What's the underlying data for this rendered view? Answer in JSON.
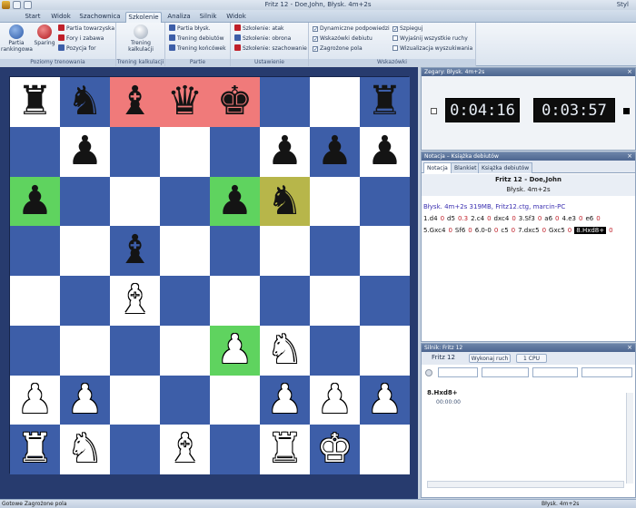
{
  "window": {
    "title": "Fritz 12 - Doe,John, Błysk. 4m+2s",
    "style_label": "Styl"
  },
  "tabs": [
    {
      "label": "Start"
    },
    {
      "label": "Widok"
    },
    {
      "label": "Szachownica"
    },
    {
      "label": "Szkolenie",
      "active": true
    },
    {
      "label": "Analiza"
    },
    {
      "label": "Silnik"
    },
    {
      "label": "Widok"
    }
  ],
  "ribbon": {
    "ranked": {
      "btn1": "Partia rankingowa",
      "btn2": "Sparing",
      "small": [
        "Partia towarzyska",
        "Fory i zabawa",
        "Pozycja for"
      ],
      "label": "Poziomy trenowania"
    },
    "calc": {
      "btn": "Trening kalkulacji",
      "label": "Trening kalkulacji"
    },
    "partie": {
      "items": [
        "Partia błysk.",
        "Trening debiutów",
        "Trening końcówek"
      ],
      "label": "Partie"
    },
    "ustawienie": {
      "items": [
        "Szkolenie: atak",
        "Szkolenie: obrona",
        "Szkolenie: szachowanie"
      ],
      "label": "Ustawienie"
    },
    "wskazowki": {
      "col1": [
        {
          "label": "Dynamiczne podpowiedzi",
          "checked": true
        },
        {
          "label": "Wskazówki debiutu",
          "checked": true
        },
        {
          "label": "Zagrożone pola",
          "checked": true
        }
      ],
      "col2": [
        {
          "label": "Szpieguj",
          "checked": true
        },
        {
          "label": "Wyjaśnij wszystkie ruchy",
          "checked": false
        },
        {
          "label": "Wizualizacja wyszukiwania",
          "checked": false
        }
      ],
      "label": "Wskazówki"
    }
  },
  "board": {
    "rows": [
      [
        "bR",
        "bN",
        "bB",
        "bQ",
        "bK",
        "",
        "",
        "bR"
      ],
      [
        "",
        "bP",
        "",
        "",
        "",
        "bP",
        "bP",
        "bP"
      ],
      [
        "bP",
        "",
        "",
        "",
        "bP",
        "bN",
        "",
        ""
      ],
      [
        "",
        "",
        "bB",
        "",
        "",
        "",
        "",
        ""
      ],
      [
        "",
        "",
        "wB",
        "",
        "",
        "",
        "",
        ""
      ],
      [
        "",
        "",
        "",
        "",
        "wP",
        "wN",
        "",
        ""
      ],
      [
        "wP",
        "wP",
        "",
        "",
        "",
        "wP",
        "wP",
        "wP"
      ],
      [
        "wR",
        "wN",
        "",
        "wB",
        "",
        "wR",
        "wK",
        ""
      ]
    ],
    "highlights": [
      {
        "row": 0,
        "col": 2,
        "type": "red"
      },
      {
        "row": 0,
        "col": 3,
        "type": "red"
      },
      {
        "row": 0,
        "col": 4,
        "type": "red"
      },
      {
        "row": 2,
        "col": 0,
        "type": "green"
      },
      {
        "row": 2,
        "col": 4,
        "type": "green"
      },
      {
        "row": 2,
        "col": 5,
        "type": "olive"
      },
      {
        "row": 5,
        "col": 4,
        "type": "green"
      }
    ]
  },
  "clocks": {
    "header": "Zegary: Błysk. 4m+2s",
    "white_time": "0:04:16",
    "black_time": "0:03:57"
  },
  "notation": {
    "header": "Notacja – Książka debiutów",
    "tabs": [
      "Notacja",
      "Blankiet",
      "Książka debiutów"
    ],
    "players": "Fritz 12 - Doe,John",
    "event": "Błysk. 4m+2s",
    "info": "Błysk. 4m+2s  319MB, Fritz12.ctg, marcin-PC",
    "line1": [
      {
        "t": "1.d4"
      },
      {
        "t": "0",
        "red": true
      },
      {
        "t": "d5"
      },
      {
        "t": "0.3",
        "red": true
      },
      {
        "t": "2.c4"
      },
      {
        "t": "0",
        "red": true
      },
      {
        "t": "dxc4"
      },
      {
        "t": "0",
        "red": true
      },
      {
        "t": "3.Sf3"
      },
      {
        "t": "0",
        "red": true
      },
      {
        "t": "a6"
      },
      {
        "t": "0",
        "red": true
      },
      {
        "t": "4.e3"
      },
      {
        "t": "0",
        "red": true
      },
      {
        "t": "e6"
      },
      {
        "t": "0",
        "red": true
      }
    ],
    "line2": [
      {
        "t": "5.Gxc4"
      },
      {
        "t": "0",
        "red": true
      },
      {
        "t": "Sf6"
      },
      {
        "t": "0",
        "red": true
      },
      {
        "t": "6.0-0"
      },
      {
        "t": "0",
        "red": true
      },
      {
        "t": "c5"
      },
      {
        "t": "0",
        "red": true
      },
      {
        "t": "7.dxc5"
      },
      {
        "t": "0",
        "red": true
      },
      {
        "t": "Gxc5"
      },
      {
        "t": "0",
        "red": true
      },
      {
        "t": "8.Hxd8+",
        "cur": true
      },
      {
        "t": "0",
        "red": true
      }
    ]
  },
  "engine": {
    "header": "Silnik: Fritz 12",
    "name": "Fritz 12",
    "move_button": "Wykonaj ruch",
    "cpu_button": "1 CPU",
    "best_line": "8.Hxd8+",
    "time": "00:00:00"
  },
  "status": {
    "left": "Gotowe   Zagrożone pola",
    "right": "Błysk. 4m+2s"
  }
}
